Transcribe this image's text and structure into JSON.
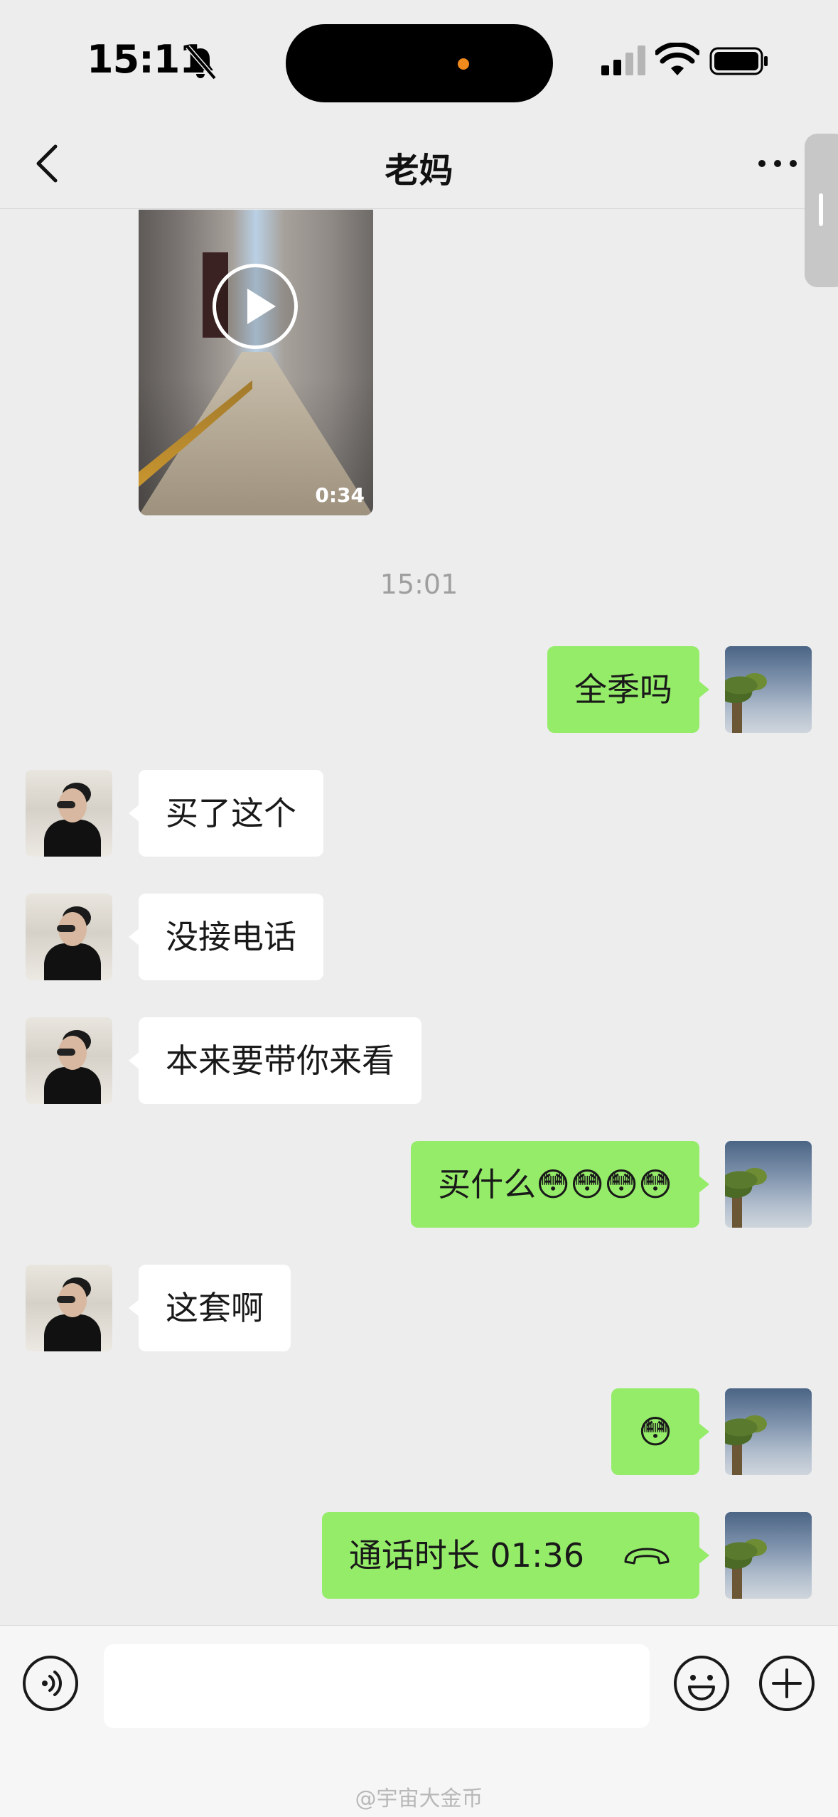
{
  "status_bar": {
    "time": "15:11"
  },
  "nav": {
    "title": "老妈"
  },
  "video": {
    "duration": "0:34"
  },
  "timestamp": "15:01",
  "messages": [
    {
      "from": "me",
      "text": "全季吗"
    },
    {
      "from": "mom",
      "text": "买了这个"
    },
    {
      "from": "mom",
      "text": "没接电话"
    },
    {
      "from": "mom",
      "text": "本来要带你来看"
    },
    {
      "from": "me",
      "text": "买什么😳😳😳😳"
    },
    {
      "from": "mom",
      "text": "这套啊"
    },
    {
      "from": "me",
      "text": "😳"
    },
    {
      "from": "me",
      "text": "通话时长 01:36"
    }
  ],
  "input": {
    "placeholder": ""
  },
  "watermark": "@宇宙大金币",
  "colors": {
    "sent_bubble": "#95ec69",
    "received_bubble": "#ffffff",
    "background": "#ededed"
  }
}
